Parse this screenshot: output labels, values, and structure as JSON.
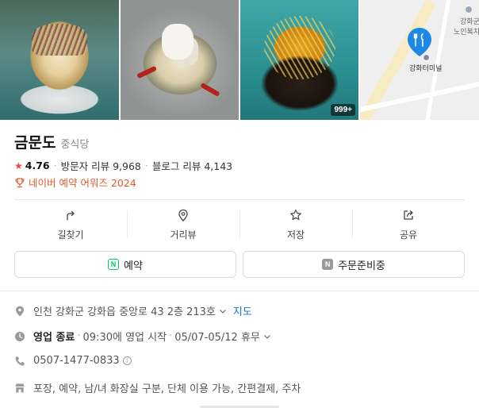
{
  "photos": {
    "items": [
      {
        "alt": "food-photo-1"
      },
      {
        "alt": "food-photo-2"
      },
      {
        "alt": "food-photo-3",
        "badge": "999+"
      },
      {
        "alt": "map-thumbnail"
      }
    ],
    "map": {
      "terminal_label": "강화터미널",
      "corner_label_1": "강화군",
      "corner_label_2": "노인복지"
    }
  },
  "place": {
    "name": "금문도",
    "category": "중식당",
    "rating": "4.76",
    "visitor_reviews_label": "방문자 리뷰",
    "visitor_reviews": "9,968",
    "blog_reviews_label": "블로그 리뷰",
    "blog_reviews": "4,143",
    "award": "네이버 예약 어워즈 2024"
  },
  "actions": [
    {
      "label": "길찾기",
      "icon": "directions-icon"
    },
    {
      "label": "거리뷰",
      "icon": "location-pin-icon"
    },
    {
      "label": "저장",
      "icon": "star-icon"
    },
    {
      "label": "공유",
      "icon": "share-icon"
    }
  ],
  "buttons": {
    "reserve": "예약",
    "order_prep": "주문준비중"
  },
  "info": {
    "address": "인천 강화군 강화읍 중앙로 43 2층 213호",
    "map_link": "지도",
    "status": "영업 종료",
    "hours": "09:30에 영업 시작",
    "holiday": "05/07-05/12 휴무",
    "phone": "0507-1477-0833",
    "amenities": "포장, 예약, 남/녀 화장실 구분, 단체 이용 가능, 간편결제, 주차"
  },
  "colors": {
    "accent_red": "#f1473f",
    "award_orange": "#e25a2c",
    "naver_green": "#03c75a",
    "link_blue": "#1b6dd6",
    "map_pin_blue": "#1e88e5"
  }
}
